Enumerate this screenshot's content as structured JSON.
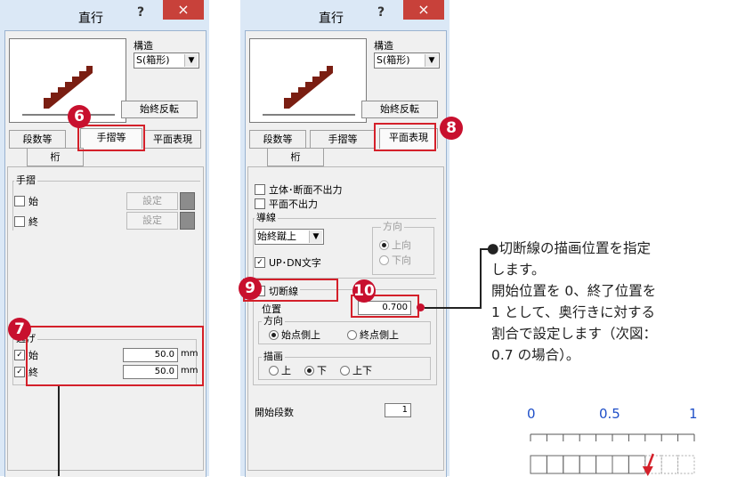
{
  "colors": {
    "accent_red": "#c8102e",
    "scale_blue": "#1f4fc8",
    "stair": "#7a1e12"
  },
  "left": {
    "title": "直行",
    "help": "?",
    "close": "×",
    "struct_label": "構造",
    "struct_value": "S(箱形)",
    "reverse_button": "始終反転",
    "tabs": [
      "段数等",
      "手摺等",
      "平面表現"
    ],
    "tab2": "桁",
    "handrail_group": "手摺",
    "handrail_start": "始",
    "handrail_end": "終",
    "setting": "設定",
    "escape_group": "逃げ",
    "escape_start": "始",
    "escape_end": "終",
    "escape_start_value": "50.0",
    "escape_end_value": "50.0",
    "unit": "mm",
    "check_mark": "✓",
    "close_icon": "close-icon"
  },
  "right": {
    "title": "直行",
    "help": "?",
    "close": "×",
    "struct_label": "構造",
    "struct_value": "S(箱形)",
    "reverse_button": "始終反転",
    "tabs": [
      "段数等",
      "手摺等",
      "平面表現"
    ],
    "tab2": "桁",
    "no_3d": "立体･断面不出力",
    "no_plan": "平面不出力",
    "guide_group": "導線",
    "guide_value": "始終蹴上",
    "direction_group": "方向",
    "dir_up": "上向",
    "dir_down": "下向",
    "updn_text": "UP･DN文字",
    "cut_line": "切断線",
    "position_label": "位置",
    "position_value": "0.700",
    "cut_direction_group": "方向",
    "start_side": "始点側上",
    "end_side": "終点側上",
    "draw_group": "描画",
    "draw_up": "上",
    "draw_down": "下",
    "draw_updown": "上下",
    "start_steps_label": "開始段数",
    "start_steps_value": "1",
    "check_mark": "✓"
  },
  "markers": [
    "6",
    "7",
    "8",
    "9",
    "10"
  ],
  "note": {
    "lines": [
      "●切断線の描画位置を指定",
      "します。",
      "開始位置を 0、終了位置を",
      "1 として、奥行きに対する",
      "割合で設定します（次図：",
      "0.7 の場合）。"
    ]
  },
  "scale": {
    "labels": [
      "0",
      "0.5",
      "1"
    ],
    "position_fraction": 0.7
  }
}
